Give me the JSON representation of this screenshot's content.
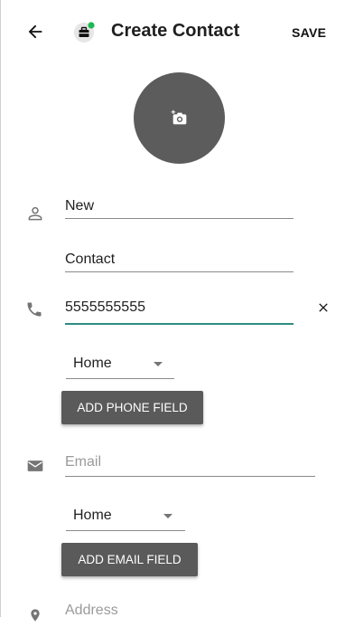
{
  "header": {
    "title": "Create Contact",
    "save_label": "SAVE",
    "back_icon": "arrow-left-icon",
    "account_icon": "briefcase-badge-icon"
  },
  "photo": {
    "icon": "add-photo-icon"
  },
  "name": {
    "first": "New",
    "last": "Contact"
  },
  "phone": {
    "value": "5555555555",
    "type": "Home",
    "add_label": "ADD PHONE FIELD",
    "clear_icon": "close-icon"
  },
  "email": {
    "placeholder": "Email",
    "type": "Home",
    "add_label": "ADD EMAIL FIELD"
  },
  "address": {
    "placeholder": "Address"
  },
  "colors": {
    "accent": "#2f8c83",
    "button": "#5a5a5a",
    "photo_bg": "#5c5c5c",
    "badge": "#1db954"
  }
}
